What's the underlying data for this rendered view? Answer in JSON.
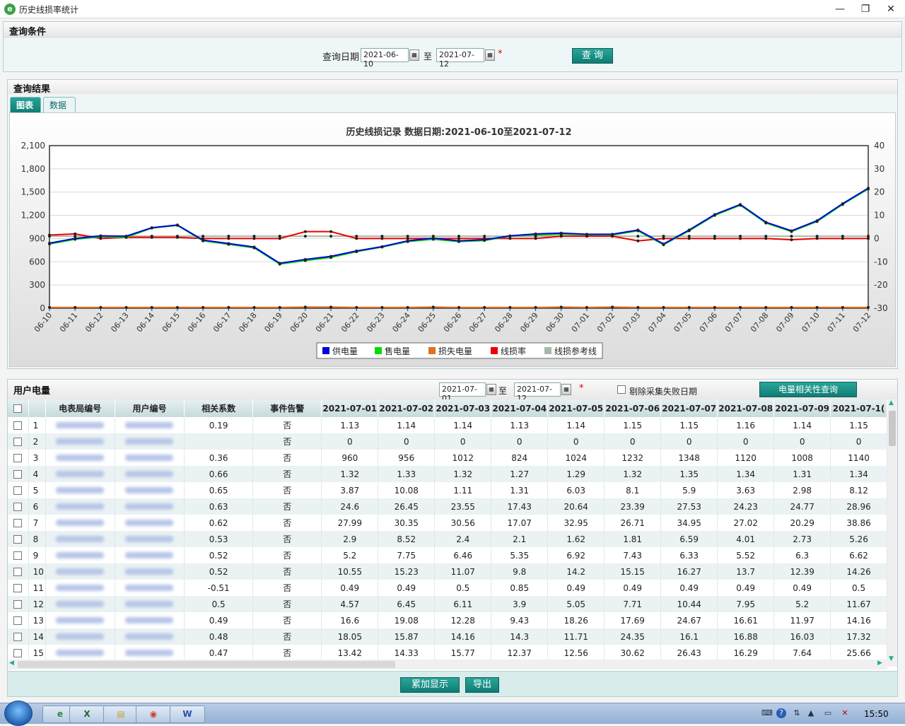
{
  "window": {
    "title": "历史线损率统计",
    "minimize": "—",
    "restore": "❐",
    "close": "✕",
    "app_icon": "e"
  },
  "query": {
    "section_title": "查询条件",
    "date_label": "查询日期",
    "start_date": "2021-06-10",
    "to": "至",
    "end_date": "2021-07-12",
    "required_mark": "*",
    "query_button": "查 询"
  },
  "results": {
    "section_title": "查询结果",
    "tabs": [
      "图表",
      "数据"
    ],
    "active_tab": "图表"
  },
  "chart_data": {
    "type": "line",
    "title": "历史线损记录  数据日期:2021-06-10至2021-07-12",
    "x": [
      "06-10",
      "06-11",
      "06-12",
      "06-13",
      "06-14",
      "06-15",
      "06-16",
      "06-17",
      "06-18",
      "06-19",
      "06-20",
      "06-21",
      "06-22",
      "06-23",
      "06-24",
      "06-25",
      "06-26",
      "06-27",
      "06-28",
      "06-29",
      "06-30",
      "07-01",
      "07-02",
      "07-03",
      "07-04",
      "07-05",
      "07-06",
      "07-07",
      "07-08",
      "07-09",
      "07-10",
      "07-11",
      "07-12"
    ],
    "y_left_ticks": [
      "0",
      "300",
      "600",
      "900",
      "1,200",
      "1,500",
      "1,800",
      "2,100"
    ],
    "y_left_range": [
      0,
      2100
    ],
    "y_right_ticks": [
      "-30",
      "-20",
      "-10",
      "0",
      "10",
      "20",
      "30",
      "40"
    ],
    "y_right_range": [
      -30,
      40
    ],
    "grid": true,
    "legend_position": "bottom",
    "series": [
      {
        "name": "供电量",
        "axis": "left",
        "color": "#0000dd",
        "values": [
          840,
          900,
          935,
          930,
          1040,
          1075,
          880,
          835,
          790,
          580,
          630,
          670,
          740,
          795,
          870,
          905,
          870,
          885,
          935,
          960,
          970,
          955,
          955,
          1010,
          830,
          1010,
          1210,
          1340,
          1110,
          1000,
          1130,
          1350,
          1550
        ]
      },
      {
        "name": "售电量",
        "axis": "left",
        "color": "#00dd00",
        "values": [
          830,
          890,
          925,
          915,
          1035,
          1070,
          870,
          825,
          780,
          570,
          615,
          655,
          730,
          790,
          860,
          890,
          860,
          875,
          930,
          945,
          955,
          950,
          945,
          1000,
          820,
          1000,
          1200,
          1330,
          1100,
          990,
          1120,
          1340,
          1540
        ]
      },
      {
        "name": "损失电量",
        "axis": "left",
        "color": "#e07020",
        "values": [
          10,
          10,
          10,
          10,
          10,
          10,
          10,
          10,
          10,
          10,
          15,
          15,
          10,
          10,
          10,
          15,
          10,
          10,
          10,
          10,
          15,
          10,
          15,
          10,
          10,
          10,
          10,
          10,
          10,
          10,
          10,
          10,
          10
        ]
      },
      {
        "name": "线损率",
        "axis": "right",
        "color": "#ee0000",
        "values": [
          1.5,
          2,
          0,
          0.5,
          0.5,
          0.5,
          0,
          0,
          0,
          0,
          3,
          3,
          0,
          0,
          0,
          0,
          0,
          0,
          0,
          0,
          1,
          1,
          1,
          -1,
          0,
          0,
          0,
          0,
          0,
          -0.5,
          0,
          0,
          0
        ]
      },
      {
        "name": "线损参考线",
        "axis": "right",
        "color": "#a8b8a8",
        "values": [
          1,
          1,
          1,
          1,
          1,
          1,
          1,
          1,
          1,
          1,
          1,
          1,
          1,
          1,
          1,
          1,
          1,
          1,
          1,
          1,
          1,
          1,
          1,
          1,
          1,
          1,
          1,
          1,
          1,
          1,
          1,
          1,
          1
        ]
      }
    ]
  },
  "user_power": {
    "section_title": "用户电量",
    "start_date": "2021-07-01",
    "to": "至",
    "end_date": "2021-07-12",
    "required_mark": "*",
    "exclude_label": "剔除采集失败日期",
    "corr_button": "电量相关性查询",
    "columns": [
      "电表局编号",
      "用户编号",
      "相关系数",
      "事件告警",
      "2021-07-01",
      "2021-07-02",
      "2021-07-03",
      "2021-07-04",
      "2021-07-05",
      "2021-07-06",
      "2021-07-07",
      "2021-07-08",
      "2021-07-09",
      "2021-07-1("
    ],
    "rows": [
      {
        "no": "1",
        "coef": "0.19",
        "alarm": "否",
        "d": [
          "1.13",
          "1.14",
          "1.14",
          "1.13",
          "1.14",
          "1.15",
          "1.15",
          "1.16",
          "1.14",
          "1.15"
        ]
      },
      {
        "no": "2",
        "coef": "",
        "alarm": "否",
        "d": [
          "0",
          "0",
          "0",
          "0",
          "0",
          "0",
          "0",
          "0",
          "0",
          "0"
        ]
      },
      {
        "no": "3",
        "coef": "0.36",
        "alarm": "否",
        "d": [
          "960",
          "956",
          "1012",
          "824",
          "1024",
          "1232",
          "1348",
          "1120",
          "1008",
          "1140"
        ]
      },
      {
        "no": "4",
        "coef": "0.66",
        "alarm": "否",
        "d": [
          "1.32",
          "1.33",
          "1.32",
          "1.27",
          "1.29",
          "1.32",
          "1.35",
          "1.34",
          "1.31",
          "1.34"
        ]
      },
      {
        "no": "5",
        "coef": "0.65",
        "alarm": "否",
        "d": [
          "3.87",
          "10.08",
          "1.11",
          "1.31",
          "6.03",
          "8.1",
          "5.9",
          "3.63",
          "2.98",
          "8.12"
        ]
      },
      {
        "no": "6",
        "coef": "0.63",
        "alarm": "否",
        "d": [
          "24.6",
          "26.45",
          "23.55",
          "17.43",
          "20.64",
          "23.39",
          "27.53",
          "24.23",
          "24.77",
          "28.96"
        ]
      },
      {
        "no": "7",
        "coef": "0.62",
        "alarm": "否",
        "d": [
          "27.99",
          "30.35",
          "30.56",
          "17.07",
          "32.95",
          "26.71",
          "34.95",
          "27.02",
          "20.29",
          "38.86"
        ]
      },
      {
        "no": "8",
        "coef": "0.53",
        "alarm": "否",
        "d": [
          "2.9",
          "8.52",
          "2.4",
          "2.1",
          "1.62",
          "1.81",
          "6.59",
          "4.01",
          "2.73",
          "5.26"
        ]
      },
      {
        "no": "9",
        "coef": "0.52",
        "alarm": "否",
        "d": [
          "5.2",
          "7.75",
          "6.46",
          "5.35",
          "6.92",
          "7.43",
          "6.33",
          "5.52",
          "6.3",
          "6.62"
        ]
      },
      {
        "no": "10",
        "coef": "0.52",
        "alarm": "否",
        "d": [
          "10.55",
          "15.23",
          "11.07",
          "9.8",
          "14.2",
          "15.15",
          "16.27",
          "13.7",
          "12.39",
          "14.26"
        ]
      },
      {
        "no": "11",
        "coef": "-0.51",
        "alarm": "否",
        "d": [
          "0.49",
          "0.49",
          "0.5",
          "0.85",
          "0.49",
          "0.49",
          "0.49",
          "0.49",
          "0.49",
          "0.5"
        ]
      },
      {
        "no": "12",
        "coef": "0.5",
        "alarm": "否",
        "d": [
          "4.57",
          "6.45",
          "6.11",
          "3.9",
          "5.05",
          "7.71",
          "10.44",
          "7.95",
          "5.2",
          "11.67"
        ]
      },
      {
        "no": "13",
        "coef": "0.49",
        "alarm": "否",
        "d": [
          "16.6",
          "19.08",
          "12.28",
          "9.43",
          "18.26",
          "17.69",
          "24.67",
          "16.61",
          "11.97",
          "14.16"
        ]
      },
      {
        "no": "14",
        "coef": "0.48",
        "alarm": "否",
        "d": [
          "18.05",
          "15.87",
          "14.16",
          "14.3",
          "11.71",
          "24.35",
          "16.1",
          "16.88",
          "16.03",
          "17.32"
        ]
      },
      {
        "no": "15",
        "coef": "0.47",
        "alarm": "否",
        "d": [
          "13.42",
          "14.33",
          "15.77",
          "12.37",
          "12.56",
          "30.62",
          "26.43",
          "16.29",
          "7.64",
          "25.66"
        ]
      }
    ],
    "accumulate_button": "累加显示",
    "export_button": "导出"
  },
  "taskbar": {
    "apps": [
      "e",
      "X",
      "▤",
      "◉",
      "W"
    ],
    "clock": "15:50"
  }
}
